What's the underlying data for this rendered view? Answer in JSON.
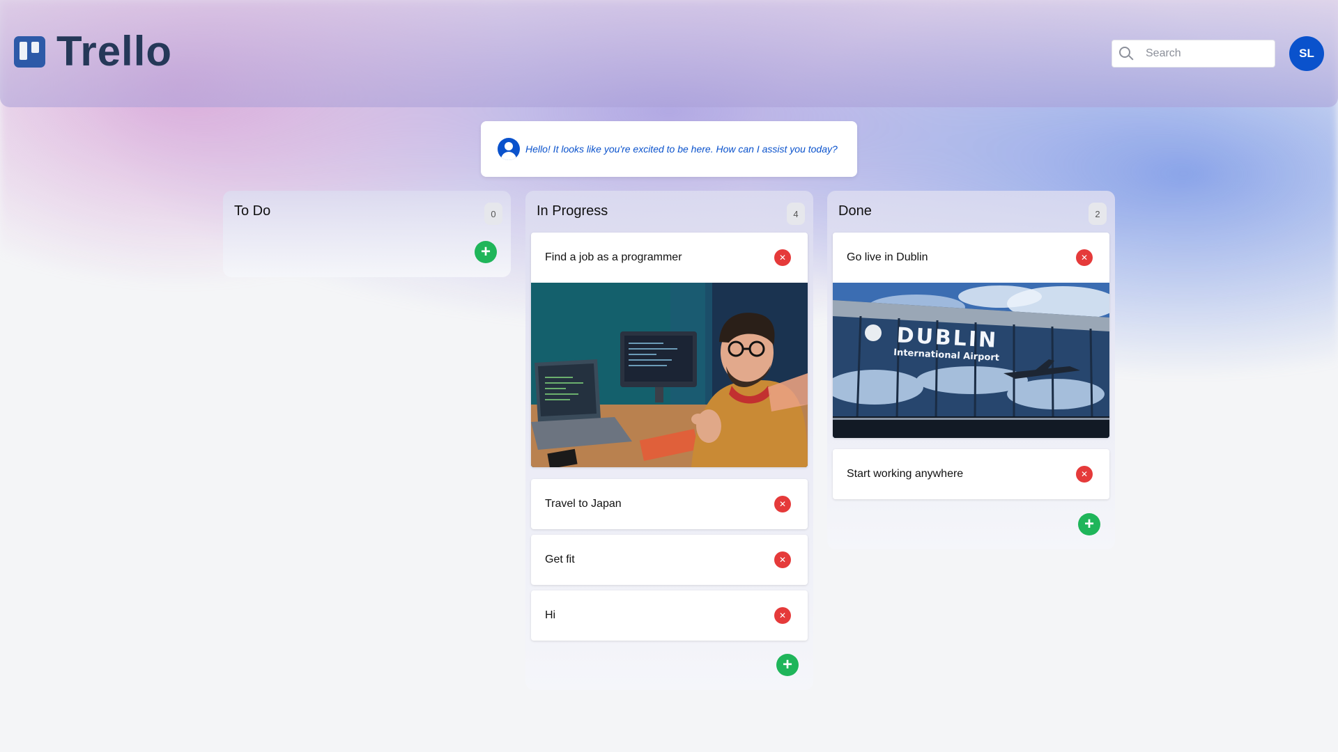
{
  "header": {
    "logo_text": "Trello",
    "search_placeholder": "Search",
    "avatar_initials": "SL"
  },
  "assistant": {
    "message": "Hello! It looks like you're excited to be here. How can I assist you today?"
  },
  "columns": [
    {
      "title": "To Do",
      "count": "0",
      "cards": []
    },
    {
      "title": "In Progress",
      "count": "4",
      "cards": [
        {
          "title": "Find a job as a programmer",
          "image": "programmer-selfie-photo"
        },
        {
          "title": "Travel to Japan"
        },
        {
          "title": "Get fit"
        },
        {
          "title": "Hi"
        }
      ]
    },
    {
      "title": "Done",
      "count": "2",
      "cards": [
        {
          "title": "Go live in Dublin",
          "image": "dublin-airport-photo",
          "image_text": {
            "line1": "DUBLIN",
            "line2": "International Airport"
          }
        },
        {
          "title": "Start working anywhere"
        }
      ]
    }
  ],
  "icons": {
    "delete": "close-icon",
    "add": "plus-icon",
    "search": "search-icon",
    "assistant": "user-icon"
  },
  "colors": {
    "accent": "#0a52cc",
    "delete": "#e53a3a",
    "add": "#1fb55a",
    "logo": "#253858"
  }
}
